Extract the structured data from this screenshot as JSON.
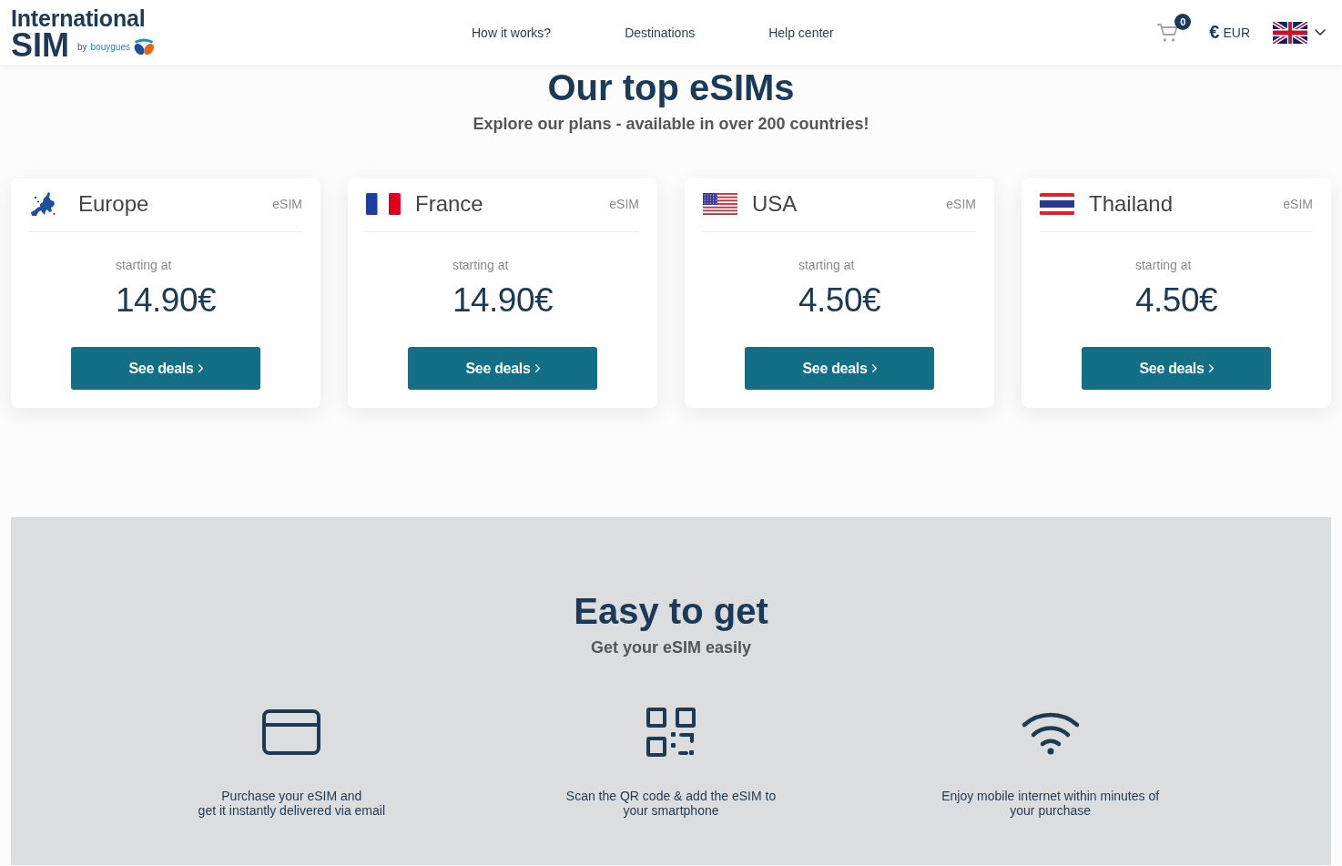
{
  "header": {
    "logo": {
      "title": "International",
      "subtitle": "SIM",
      "byline": "by",
      "brand": "bouygues"
    },
    "nav": [
      "How it works?",
      "Destinations",
      "Help center"
    ],
    "cart": {
      "count": "0"
    },
    "currency": {
      "symbol": "€",
      "code": "EUR"
    }
  },
  "top_esims": {
    "title": "Our top eSIMs",
    "subtitle": "Explore our plans - available in over 200 countries!",
    "cards": [
      {
        "kind": "europe",
        "name": "Europe",
        "tag": "eSIM",
        "label": "starting at",
        "price": "14.90€",
        "button": "See deals"
      },
      {
        "kind": "france",
        "name": "France",
        "tag": "eSIM",
        "label": "starting at",
        "price": "14.90€",
        "button": "See deals"
      },
      {
        "kind": "usa",
        "name": "USA",
        "tag": "eSIM",
        "label": "starting at",
        "price": "4.50€",
        "button": "See deals"
      },
      {
        "kind": "thailand",
        "name": "Thailand",
        "tag": "eSIM",
        "label": "starting at",
        "price": "4.50€",
        "button": "See deals"
      }
    ]
  },
  "easy_to_get": {
    "title": "Easy to get",
    "subtitle": "Get your eSIM easily",
    "steps": [
      {
        "kind": "card",
        "text": "Purchase your eSIM and\nget it instantly delivered via email"
      },
      {
        "kind": "qr",
        "text": "Scan the QR code & add the eSIM to\nyour smartphone"
      },
      {
        "kind": "wifi",
        "text": "Enjoy mobile internet within minutes of\nyour purchase"
      }
    ]
  }
}
